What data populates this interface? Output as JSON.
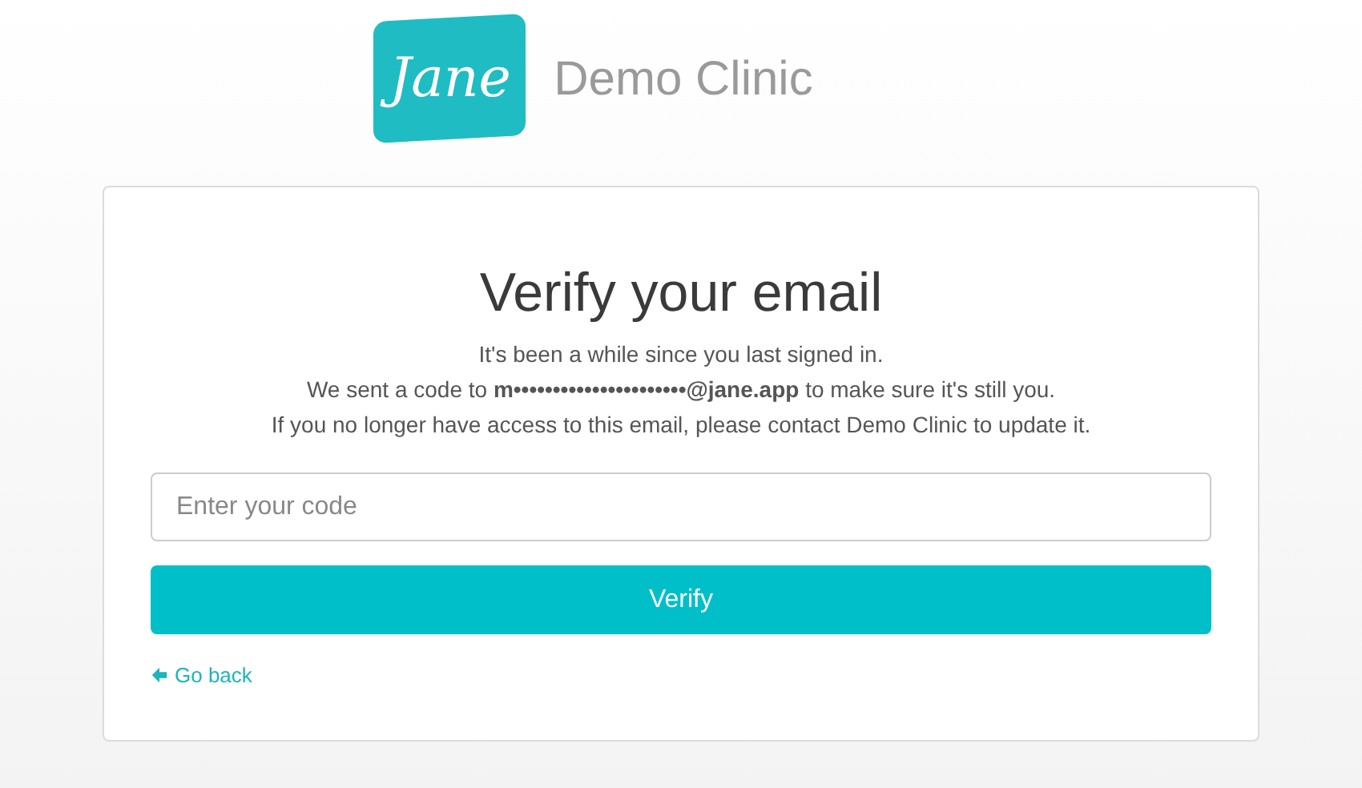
{
  "logo": {
    "mark": "Jane",
    "clinic": "Demo Clinic"
  },
  "card": {
    "title": "Verify your email",
    "lines": [
      "It's been a while since you last signed in.",
      "We sent a code to **m••••••••••••••••••••••@jane.app** to make sure it's still you.",
      "If you no longer have access to this email, please contact Demo Clinic to update it."
    ],
    "code_field": {
      "placeholder": "Enter your code"
    },
    "verify_button": "Verify",
    "back_link": "Go back"
  }
}
